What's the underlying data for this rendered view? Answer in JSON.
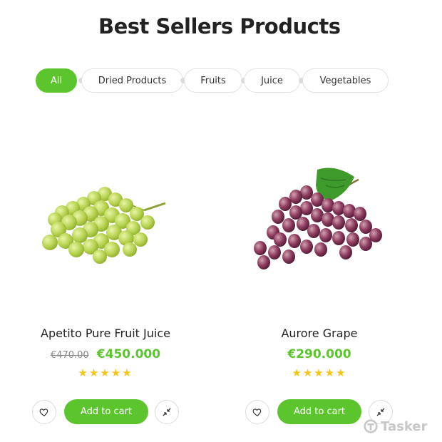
{
  "section": {
    "title": "Best Sellers Products"
  },
  "filters": [
    {
      "label": "All",
      "active": true
    },
    {
      "label": "Dried Products",
      "active": false
    },
    {
      "label": "Fruits",
      "active": false
    },
    {
      "label": "Juice",
      "active": false
    },
    {
      "label": "Vegetables",
      "active": false
    }
  ],
  "products": [
    {
      "name": "Apetito Pure Fruit Juice",
      "old_price": "€470.00",
      "price": "€450.000",
      "rating": 5,
      "stars": "★★★★★",
      "image_icon": "green-grapes-image",
      "add_to_cart": "Add to cart"
    },
    {
      "name": "Aurore Grape",
      "old_price": "",
      "price": "€290.000",
      "rating": 5,
      "stars": "★★★★★",
      "image_icon": "red-grapes-image",
      "add_to_cart": "Add to cart"
    }
  ],
  "watermark": {
    "text": "Tasker"
  },
  "colors": {
    "accent": "#5cc52d",
    "star": "#f5c518",
    "text": "#222222"
  }
}
